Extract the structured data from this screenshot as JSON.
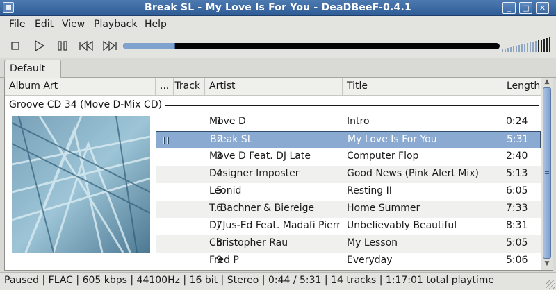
{
  "window": {
    "title": "Break SL - My Love Is For You - DeaDBeeF-0.4.1",
    "controls": [
      "minimize-icon",
      "maximize-icon",
      "close-icon"
    ]
  },
  "menu": [
    {
      "label": "File",
      "key": "F",
      "rest": "ile"
    },
    {
      "label": "Edit",
      "key": "E",
      "rest": "dit"
    },
    {
      "label": "View",
      "key": "V",
      "rest": "iew"
    },
    {
      "label": "Playback",
      "key": "P",
      "rest": "layback"
    },
    {
      "label": "Help",
      "key": "H",
      "rest": "elp"
    }
  ],
  "toolbar": {
    "buttons": [
      "stop-icon",
      "play-icon",
      "pause-icon",
      "previous-icon",
      "next-icon"
    ],
    "seek_progress": 0.1385,
    "volume_level": 1.0
  },
  "colors": {
    "titlebar": "#3a67a0",
    "selection": "#8aaad2",
    "seek_fill": "#7fa2cf"
  },
  "tabs": [
    {
      "label": "Default",
      "active": true
    }
  ],
  "playlist": {
    "columns": {
      "album_art": "Album Art",
      "playing": "...",
      "track": "Track",
      "artist": "Artist",
      "title": "Title",
      "length": "Length"
    },
    "group": "Groove CD 34 (Move D-Mix CD)",
    "rows": [
      {
        "track": "1",
        "artist": "Move D",
        "title": "Intro",
        "length": "0:24",
        "state": ""
      },
      {
        "track": "2",
        "artist": "Break SL",
        "title": "My Love Is For You",
        "length": "5:31",
        "state": "paused"
      },
      {
        "track": "3",
        "artist": "Move D Feat. DJ Late",
        "title": "Computer Flop",
        "length": "2:40",
        "state": ""
      },
      {
        "track": "4",
        "artist": "Designer Imposter",
        "title": "Good News (Pink Alert Mix)",
        "length": "5:13",
        "state": ""
      },
      {
        "track": "5",
        "artist": "Leonid",
        "title": "Resting II",
        "length": "6:05",
        "state": ""
      },
      {
        "track": "6",
        "artist": "T. Bachner & Biereige",
        "title": "Home Summer",
        "length": "7:33",
        "state": ""
      },
      {
        "track": "7",
        "artist": "DJ Jus-Ed Feat. Madafi Pierre",
        "title": "Unbelievably Beautiful",
        "length": "8:31",
        "state": ""
      },
      {
        "track": "8",
        "artist": "Christopher Rau",
        "title": "My Lesson",
        "length": "5:05",
        "state": ""
      },
      {
        "track": "9",
        "artist": "Fred P",
        "title": "Everyday",
        "length": "5:06",
        "state": ""
      }
    ]
  },
  "status": "Paused | FLAC |  605 kbps | 44100Hz | 16 bit | Stereo | 0:44 / 5:31 | 14 tracks | 1:17:01 total playtime"
}
